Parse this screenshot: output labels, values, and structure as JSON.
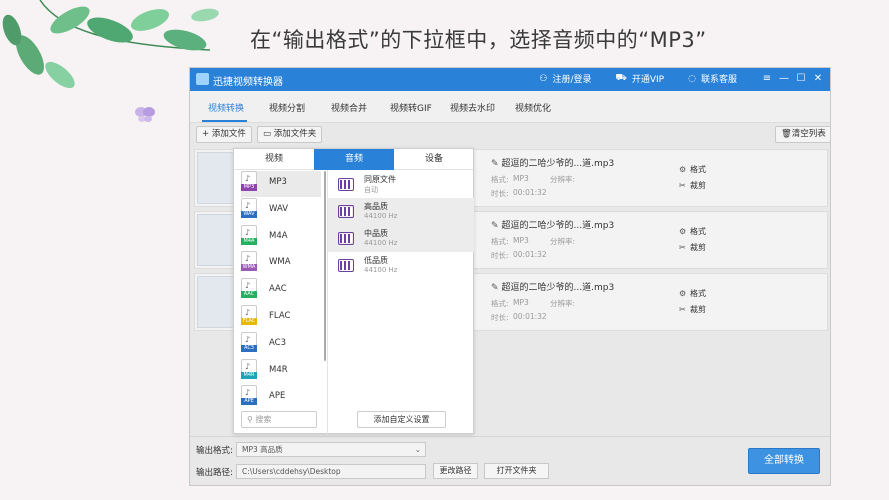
{
  "slide": {
    "title": "在“输出格式”的下拉框中，选择音频中的“MP3”"
  },
  "app": {
    "name": "迅捷视频转换器",
    "login": "注册/登录",
    "vip": "开通VIP",
    "service": "联系客服"
  },
  "tabs": [
    "视频转换",
    "视频分割",
    "视频合并",
    "视频转GIF",
    "视频去水印",
    "视频优化"
  ],
  "toolbar": {
    "add_file": "+ 添加文件",
    "add_folder": "添加文件夹",
    "clear": "清空列表"
  },
  "files": [
    {
      "name": "超逗的二哈少爷的...道.mp3",
      "format_label": "格式:",
      "format": "MP3",
      "res_label": "分辨率:",
      "dur_label": "时长:",
      "duration": "00:01:32",
      "action_format": "格式",
      "action_crop": "裁剪"
    },
    {
      "name": "超逗的二哈少爷的...道.mp3",
      "format_label": "格式:",
      "format": "MP3",
      "res_label": "分辨率:",
      "dur_label": "时长:",
      "duration": "00:01:32",
      "action_format": "格式",
      "action_crop": "裁剪"
    },
    {
      "name": "超逗的二哈少爷的...道.mp3",
      "format_label": "格式:",
      "format": "MP3",
      "res_label": "分辨率:",
      "dur_label": "时长:",
      "duration": "00:01:32",
      "action_format": "格式",
      "action_crop": "裁剪"
    }
  ],
  "popup": {
    "tabs": [
      "视频",
      "音频",
      "设备"
    ],
    "formats": [
      {
        "label": "MP3",
        "tag": "MP3",
        "color": "#8e44ad"
      },
      {
        "label": "WAV",
        "tag": "WAV",
        "color": "#2d6fbf"
      },
      {
        "label": "M4A",
        "tag": "M4A",
        "color": "#27ae60"
      },
      {
        "label": "WMA",
        "tag": "WMA",
        "color": "#9b59b6"
      },
      {
        "label": "AAC",
        "tag": "AAC",
        "color": "#27ae60"
      },
      {
        "label": "FLAC",
        "tag": "FLAC",
        "color": "#e6b800"
      },
      {
        "label": "AC3",
        "tag": "AC3",
        "color": "#2d6fbf"
      },
      {
        "label": "M4R",
        "tag": "M4R",
        "color": "#1fa3b8"
      },
      {
        "label": "APE",
        "tag": "APE",
        "color": "#2d6fbf"
      }
    ],
    "qualities": [
      {
        "name": "同原文件",
        "sub": "自动"
      },
      {
        "name": "高品质",
        "sub": "44100 Hz"
      },
      {
        "name": "中品质",
        "sub": "44100 Hz"
      },
      {
        "name": "低品质",
        "sub": "44100 Hz"
      }
    ],
    "search_placeholder": "搜索",
    "custom_button": "添加自定义设置"
  },
  "bottom": {
    "format_label": "输出格式:",
    "format_value": "MP3  高品质",
    "path_label": "输出路径:",
    "path_value": "C:\\Users\\cddehsy\\Desktop",
    "change_path": "更改路径",
    "open_folder": "打开文件夹",
    "convert_all": "全部转换"
  },
  "colors": {
    "accent": "#2a82d8",
    "convert": "#3d93e2"
  }
}
